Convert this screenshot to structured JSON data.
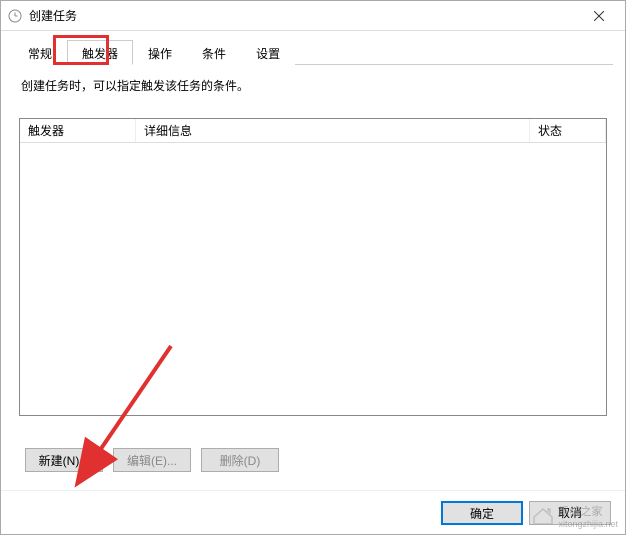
{
  "window": {
    "title": "创建任务"
  },
  "tabs": {
    "items": [
      {
        "label": "常规"
      },
      {
        "label": "触发器"
      },
      {
        "label": "操作"
      },
      {
        "label": "条件"
      },
      {
        "label": "设置"
      }
    ]
  },
  "panel": {
    "description": "创建任务时，可以指定触发该任务的条件。",
    "columns": {
      "trigger": "触发器",
      "detail": "详细信息",
      "status": "状态"
    },
    "buttons": {
      "new": "新建(N)...",
      "edit": "编辑(E)...",
      "delete": "删除(D)"
    }
  },
  "footer": {
    "ok": "确定",
    "cancel": "取消"
  },
  "watermark": {
    "text1": "系统之家",
    "text2": "xitongzhijia.net"
  }
}
